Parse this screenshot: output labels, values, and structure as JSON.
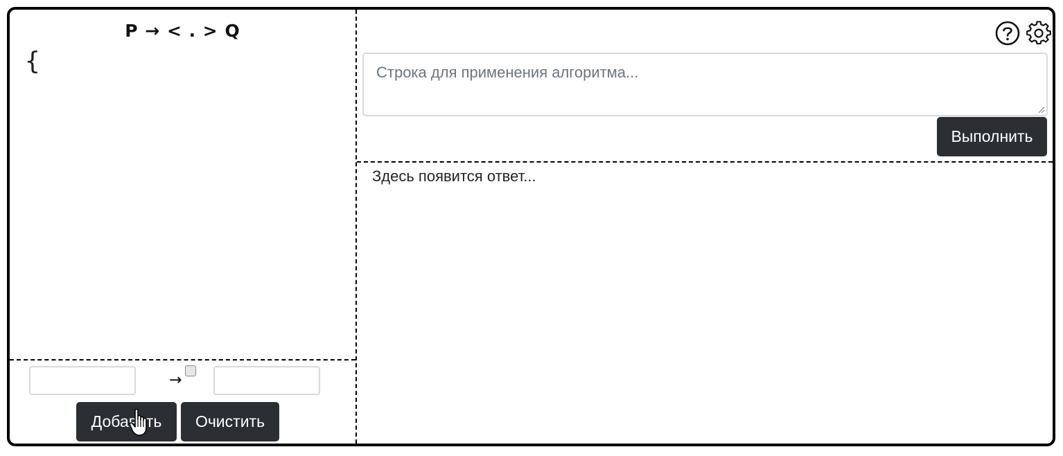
{
  "rules_panel": {
    "title": "P → < . > Q",
    "open_brace": "{",
    "arrow": "→",
    "add_button": "Добавить",
    "clear_button": "Очистить"
  },
  "run_panel": {
    "input_placeholder": "Строка для применения алгоритма...",
    "run_button": "Выполнить",
    "answer_text": "Здесь появится ответ..."
  },
  "icons": [
    "help-circle-icon",
    "gear-icon",
    "pointer-cursor-icon"
  ]
}
